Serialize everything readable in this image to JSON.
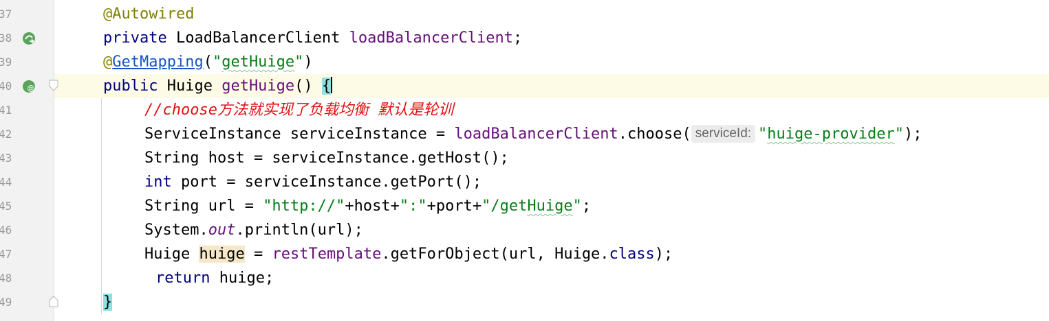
{
  "line_numbers": [
    "37",
    "38",
    "39",
    "40",
    "41",
    "42",
    "43",
    "44",
    "45",
    "46",
    "47",
    "48",
    "49"
  ],
  "gutter_icons": {
    "line38": "spring-bean-autowire-icon",
    "line40": "spring-web-endpoint-icon"
  },
  "code": {
    "l37": {
      "annotation": "@Autowired"
    },
    "l38": {
      "kw": "private",
      "type": " LoadBalancerClient ",
      "field": "loadBalancerClient",
      "end": ";"
    },
    "l39": {
      "at": "@",
      "annotation": "GetMapping",
      "p1": "(",
      "q1": "\"",
      "str": "getHuige",
      "q2": "\"",
      "p2": ")"
    },
    "l40": {
      "kw": "public",
      "type": " Huige ",
      "method": "getHuige",
      "parens": "() ",
      "brace": "{"
    },
    "l41": {
      "comment": "//choose方法就实现了负载均衡 默认是轮训"
    },
    "l42": {
      "t1": "ServiceInstance serviceInstance = ",
      "field": "loadBalancerClient",
      "t2": ".choose(",
      "hint": "serviceId:",
      "q1": "\"",
      "str": "huige-provider",
      "q2": "\"",
      "t3": ");"
    },
    "l43": {
      "text": "String host = serviceInstance.getHost();"
    },
    "l44": {
      "kw": "int",
      "text": " port = serviceInstance.getPort();"
    },
    "l45": {
      "t1": "String url = ",
      "s1": "\"http://\"",
      "t2": "+host+",
      "s2": "\":\"",
      "t3": "+port+",
      "s3a": "\"/get",
      "s3b": "Huige",
      "s3c": "\"",
      "t4": ";"
    },
    "l46": {
      "t1": "System.",
      "sfield": "out",
      "t2": ".println(url);"
    },
    "l47": {
      "t1": "Huige ",
      "var": "huige",
      "t2": " = ",
      "field": "restTemplate",
      "t3": ".getForObject(url, Huige.",
      "kw": "class",
      "t4": ");"
    },
    "l48": {
      "kw": "return",
      "text": " huige;"
    },
    "l49": {
      "brace": "}"
    }
  },
  "colors": {
    "keyword": "#000080",
    "field": "#660e7a",
    "string": "#067d17",
    "annotation": "#808000",
    "comment": "#e01010",
    "brace_match": "#8de0e0",
    "current_line": "#fdfbe6",
    "gutter": "#f2f2f2"
  }
}
